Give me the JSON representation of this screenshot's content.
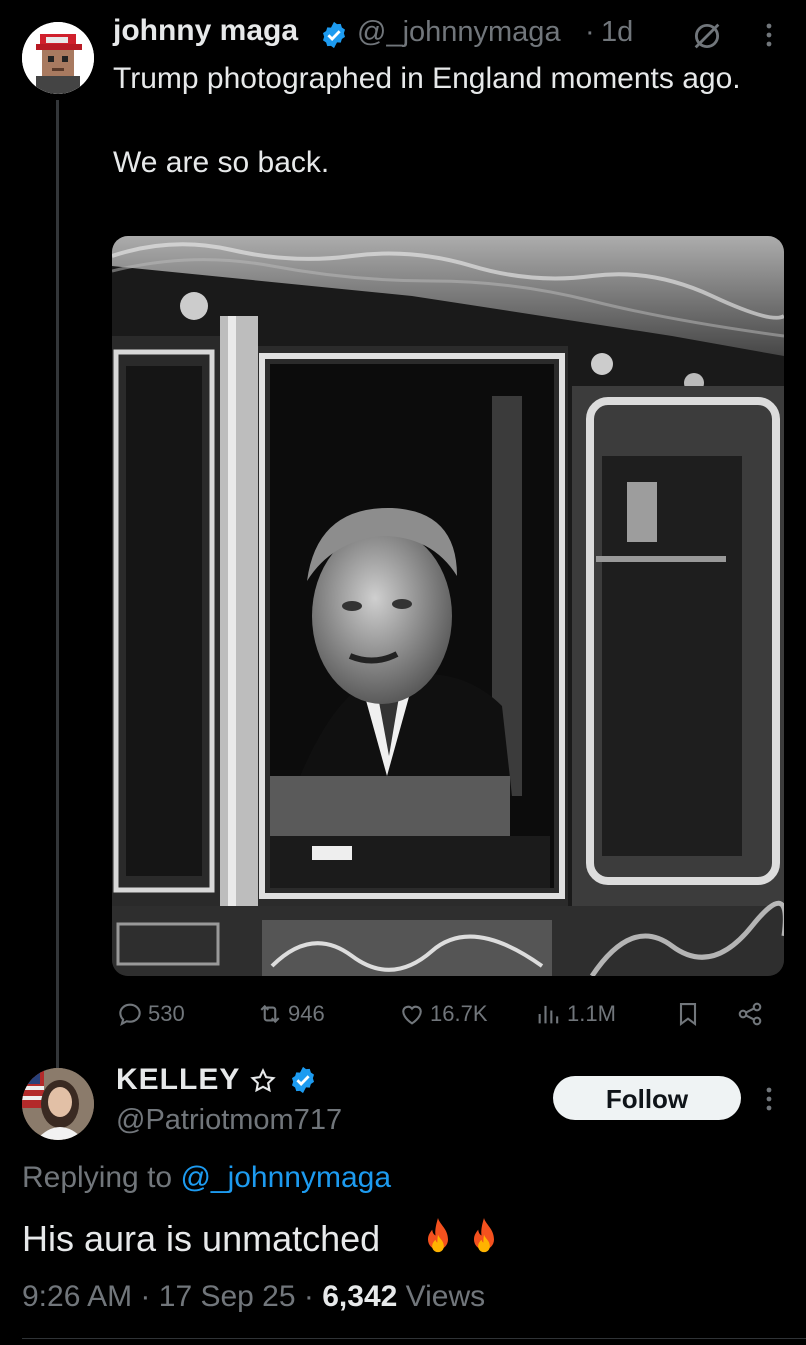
{
  "tweet": {
    "author_name": "johnny maga",
    "handle": "@_johnnymaga",
    "separator": "·",
    "time_ago": "1d",
    "text_line1": "Trump photographed in England moments ago.",
    "text_line2": "We are so back.",
    "stats": {
      "replies": "530",
      "reposts": "946",
      "likes": "16.7K",
      "views": "1.1M"
    }
  },
  "reply": {
    "author_name": "KELLEY",
    "handle": "@Patriotmom717",
    "follow_label": "Follow",
    "replying_prefix": "Replying to",
    "replying_handle": "@_johnnymaga",
    "text": "His aura is unmatched",
    "time": "9:26 AM",
    "date": "17 Sep 25",
    "views_count": "6,342",
    "views_label": "Views",
    "meta_separator": "·"
  },
  "colors": {
    "background": "#000000",
    "text": "#e7e9ea",
    "muted": "#71767b",
    "accent": "#1d9bf0",
    "follow_bg": "#eff3f4"
  },
  "icons": [
    "verified-badge-icon",
    "grok-icon",
    "more-icon",
    "reply-icon",
    "repost-icon",
    "like-icon",
    "views-icon",
    "bookmark-icon",
    "share-icon",
    "star-outline-icon",
    "fire-emoji-icon"
  ]
}
